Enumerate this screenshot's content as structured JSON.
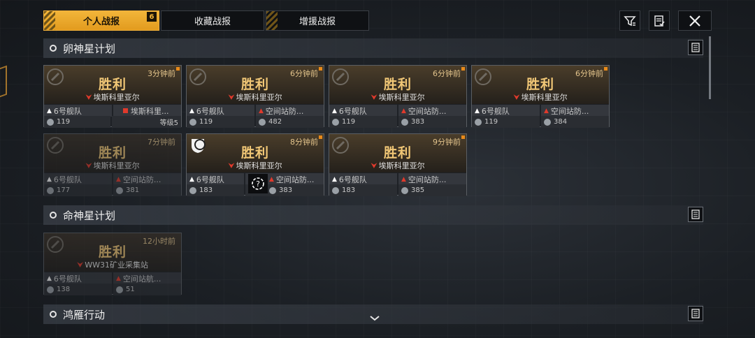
{
  "tabs": [
    {
      "label": "个人战报",
      "badge": "6",
      "active": true
    },
    {
      "label": "收藏战报",
      "active": false
    },
    {
      "label": "增援战报",
      "active": false
    }
  ],
  "toolbar": {
    "filter_icon": "filter-icon",
    "checklist_icon": "checklist-icon",
    "close_icon": "close-icon"
  },
  "sections": [
    {
      "title": "卵神星计划",
      "cards": [
        {
          "time": "3分钟前",
          "result": "胜利",
          "target": "埃斯科里亚尔",
          "fleet": "6号舰队",
          "enemy": "埃斯科里...",
          "power_left": "119",
          "power_right": "等级5",
          "dim": false
        },
        {
          "time": "6分钟前",
          "result": "胜利",
          "target": "埃斯科里亚尔",
          "fleet": "6号舰队",
          "enemy": "空间站防...",
          "power_left": "119",
          "power_right": "482",
          "dim": false
        },
        {
          "time": "6分钟前",
          "result": "胜利",
          "target": "埃斯科里亚尔",
          "fleet": "6号舰队",
          "enemy": "空间站防...",
          "power_left": "119",
          "power_right": "383",
          "dim": false
        },
        {
          "time": "6分钟前",
          "result": "胜利",
          "target": "埃斯科里亚尔",
          "fleet": "6号舰队",
          "enemy": "空间站防...",
          "power_left": "119",
          "power_right": "384",
          "dim": false
        },
        {
          "time": "7分钟前",
          "result": "胜利",
          "target": "埃斯科里亚尔",
          "fleet": "6号舰队",
          "enemy": "空间站防...",
          "power_left": "177",
          "power_right": "381",
          "dim": true
        },
        {
          "time": "8分钟前",
          "result": "胜利",
          "target": "埃斯科里亚尔",
          "fleet": "6号舰队",
          "enemy": "空间站防...",
          "power_left": "183",
          "power_right": "383",
          "dim": false
        },
        {
          "time": "9分钟前",
          "result": "胜利",
          "target": "埃斯科里亚尔",
          "fleet": "6号舰队",
          "enemy": "空间站防...",
          "power_left": "183",
          "power_right": "385",
          "dim": false
        }
      ]
    },
    {
      "title": "命神星计划",
      "cards": [
        {
          "time": "12小时前",
          "result": "胜利",
          "target": "WW31矿业采集站",
          "fleet": "6号舰队",
          "enemy": "空间站航...",
          "power_left": "138",
          "power_right": "51",
          "dim": true
        }
      ]
    },
    {
      "title": "鸿雁行动",
      "cards": []
    }
  ],
  "icons": {
    "doc": "document-icon",
    "emblem": "fleet-emblem-icon",
    "mystery": "unknown-unit-icon",
    "scroll": "chevron-down-icon"
  }
}
